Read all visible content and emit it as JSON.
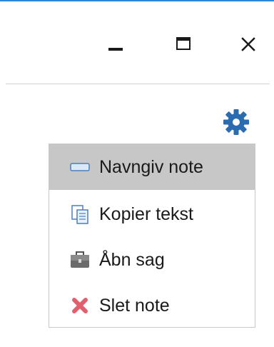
{
  "window": {
    "controls": [
      {
        "name": "minimize",
        "icon": "minimize-icon"
      },
      {
        "name": "maximize",
        "icon": "maximize-icon"
      },
      {
        "name": "close",
        "icon": "close-icon"
      }
    ],
    "accent_color": "#2b88d8"
  },
  "settings": {
    "icon": "gear-icon",
    "color": "#2b6cb0"
  },
  "menu": {
    "items": [
      {
        "label": "Navngiv note",
        "icon": "rename-icon",
        "highlighted": true
      },
      {
        "label": "Kopier tekst",
        "icon": "copy-icon",
        "highlighted": false
      },
      {
        "label": "Åbn sag",
        "icon": "briefcase-icon",
        "highlighted": false
      },
      {
        "label": "Slet note",
        "icon": "delete-x-icon",
        "highlighted": false
      }
    ],
    "highlight_color": "#c7c7c7"
  }
}
